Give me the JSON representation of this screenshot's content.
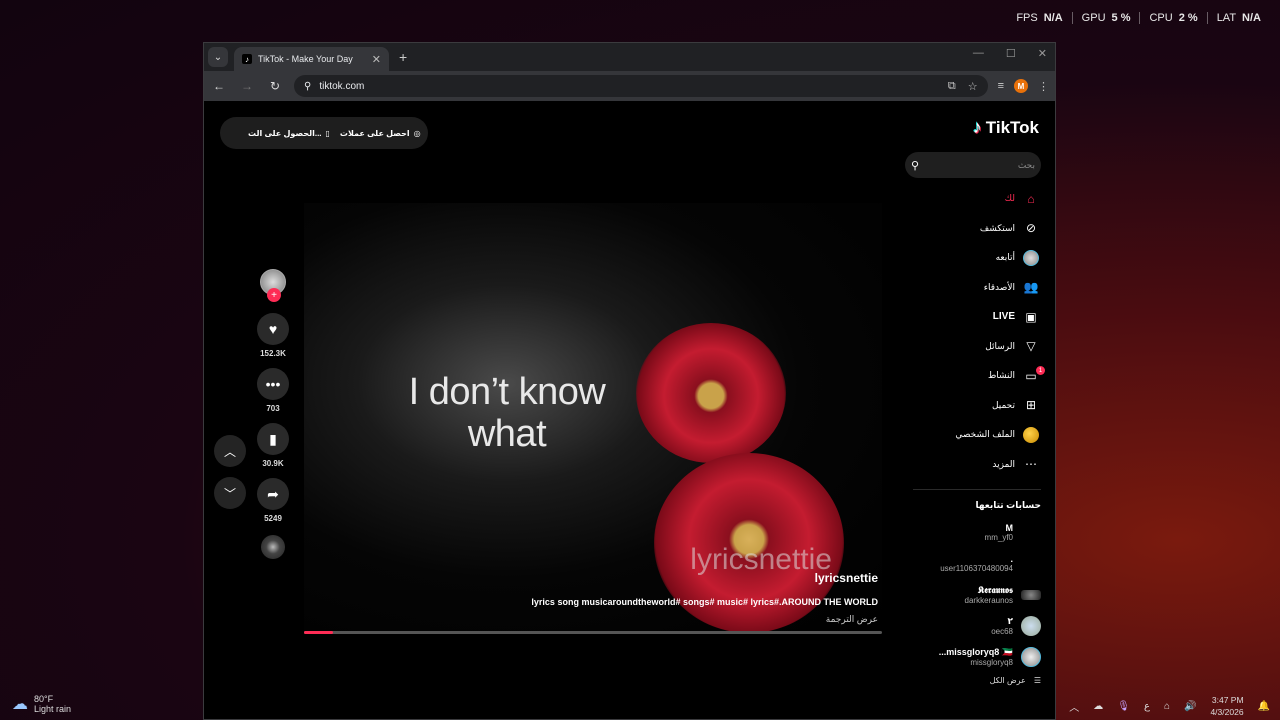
{
  "perf": [
    {
      "label": "FPS",
      "value": "N/A"
    },
    {
      "label": "GPU",
      "value": "5 %"
    },
    {
      "label": "CPU",
      "value": "2 %"
    },
    {
      "label": "LAT",
      "value": "N/A"
    }
  ],
  "browser": {
    "tab_title": "TikTok - Make Your Day",
    "url": "tiktok.com",
    "profile_initial": "M"
  },
  "topbar": {
    "coins_label": "احصل على عملات",
    "app_label": "الحصول على الت..."
  },
  "video": {
    "lyric_line1": "I don’t know",
    "lyric_line2": "what",
    "watermark": "lyricsnettie",
    "username": "lyricsnettie",
    "description": "lyrics song musicaroundtheworld# songs# music# lyrics#.AROUND THE WORLD",
    "translate": "عرض الترجمة",
    "progress_fraction": 0.05
  },
  "actions": {
    "likes": "152.3K",
    "comments": "703",
    "saves": "30.9K",
    "shares": "5249"
  },
  "sidebar": {
    "logo": "TikTok",
    "search_placeholder": "بحث",
    "menu": [
      {
        "label": "لك",
        "icon": "home-icon"
      },
      {
        "label": "استكشف",
        "icon": "compass-icon"
      },
      {
        "label": "أتابعه",
        "icon": "following-avatar-icon"
      },
      {
        "label": "الأصدقاء",
        "icon": "friends-icon"
      },
      {
        "label": "LIVE",
        "icon": "live-icon"
      },
      {
        "label": "الرسائل",
        "icon": "send-icon"
      },
      {
        "label": "النشاط",
        "icon": "activity-icon",
        "badge": "1"
      },
      {
        "label": "تحميل",
        "icon": "upload-icon"
      },
      {
        "label": "الملف الشخصي",
        "icon": "profile-icon"
      },
      {
        "label": "المزيد",
        "icon": "more-icon"
      }
    ],
    "following_title": "حسابات تتابعها",
    "accounts": [
      {
        "name": "M",
        "username": "mm_yf0"
      },
      {
        "name": ".",
        "username": "user1106370480094"
      },
      {
        "name": "𝕶𝖊𝖗𝖆𝖚𝖓𝖔𝖘",
        "username": "darkkeraunos"
      },
      {
        "name": "٢",
        "username": "oec68"
      },
      {
        "name": "missgloryq8 🇰🇼...",
        "username": "missgloryq8"
      }
    ],
    "see_all": "عرض الكل"
  },
  "taskbar": {
    "temp": "80°F",
    "weather": "Light rain",
    "lang": "ع",
    "time": "3:47 PM",
    "date": "4/3/2026"
  }
}
